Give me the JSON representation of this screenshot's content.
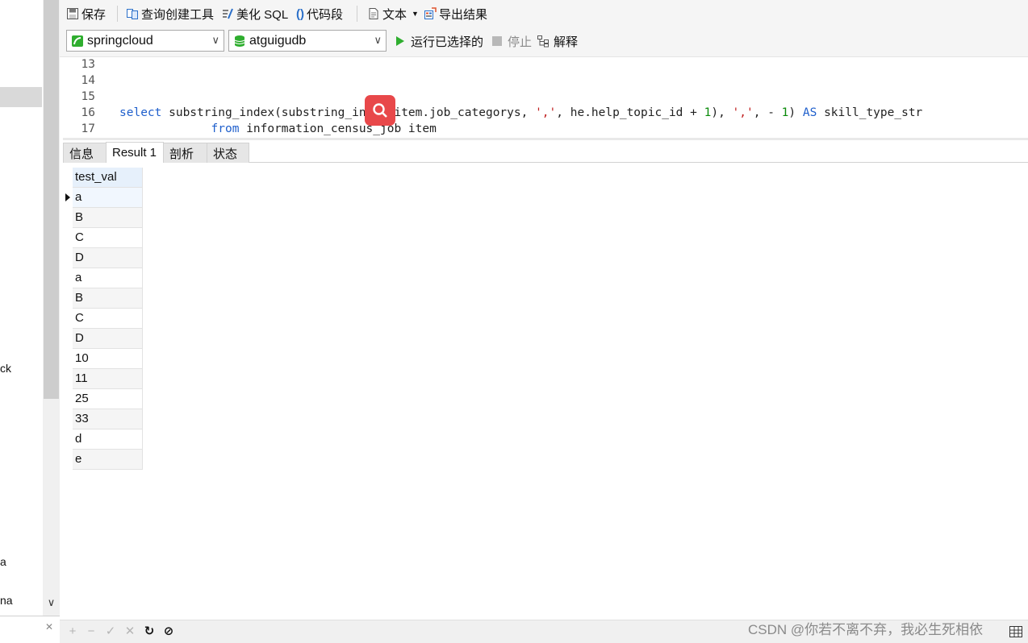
{
  "toolbar": {
    "save": "保存",
    "query_builder": "查询创建工具",
    "beautify_sql": "美化 SQL",
    "code_snippet": "代码段",
    "text_mode": "文本",
    "export_results": "导出结果"
  },
  "connection": {
    "connection_name": "springcloud",
    "database_name": "atguigudb",
    "run_selected": "运行已选择的",
    "stop": "停止",
    "explain": "解释"
  },
  "editor": {
    "lines": [
      {
        "n": "13"
      },
      {
        "n": "14"
      },
      {
        "n": "15"
      },
      {
        "n": "16",
        "tokens": [
          {
            "t": "select",
            "c": "kw"
          },
          {
            "t": " substring_index(substring_index(item.job_categorys, ",
            "c": ""
          },
          {
            "t": "','",
            "c": "str"
          },
          {
            "t": ", he.help_topic_id + ",
            "c": ""
          },
          {
            "t": "1",
            "c": "num"
          },
          {
            "t": "), ",
            "c": ""
          },
          {
            "t": "','",
            "c": "str"
          },
          {
            "t": ", - ",
            "c": ""
          },
          {
            "t": "1",
            "c": "num"
          },
          {
            "t": ") ",
            "c": ""
          },
          {
            "t": "AS",
            "c": "kw"
          },
          {
            "t": " skill_type_str",
            "c": ""
          }
        ]
      },
      {
        "n": "17",
        "tokens": [
          {
            "t": "             ",
            "c": ""
          },
          {
            "t": "from",
            "c": "kw"
          },
          {
            "t": " information_census_job item",
            "c": ""
          }
        ]
      }
    ]
  },
  "tabs": [
    {
      "label": "信息",
      "active": false
    },
    {
      "label": "Result 1",
      "active": true
    },
    {
      "label": "剖析",
      "active": false
    },
    {
      "label": "状态",
      "active": false
    }
  ],
  "result": {
    "column": "test_val",
    "rows": [
      "a",
      "B",
      "C",
      "D",
      "a",
      "B",
      "C",
      "D",
      "10",
      "11",
      "25",
      "33",
      "d",
      "e"
    ],
    "current_row_index": 0
  },
  "left_pane": {
    "fragments": [
      "ck",
      "a",
      "na"
    ]
  },
  "watermark": "CSDN @你若不离不弃，我必生死相依",
  "colors": {
    "keyword": "#1f5fcc",
    "string": "#c02020",
    "number": "#0a8a0a",
    "run_green": "#2fae2f",
    "float_button": "#e8484a",
    "header_bg": "#e6f0fb"
  }
}
